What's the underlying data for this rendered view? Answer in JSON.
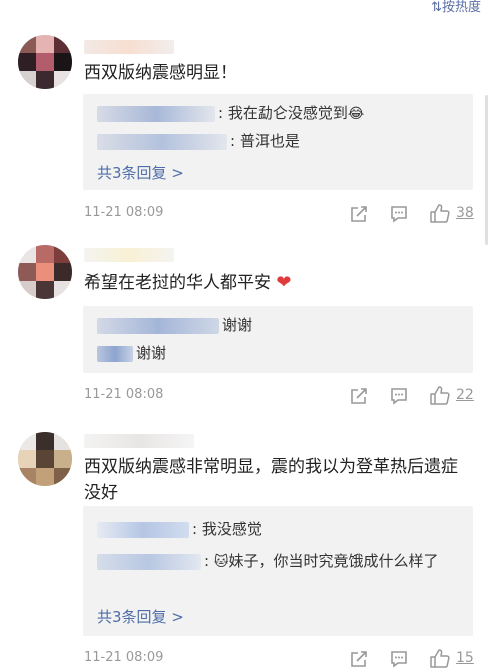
{
  "topbar": {
    "sort_label": "按热度"
  },
  "comments": [
    {
      "text": "西双版纳震感明显！",
      "replies": [
        {
          "text": ": 我在勐仑没感觉到",
          "emoji": "😂"
        },
        {
          "text": ": 普洱也是"
        }
      ],
      "more_label": "共3条回复 >",
      "time": "11-21 08:09",
      "likes": "38"
    },
    {
      "text": "希望在老挝的华人都平安",
      "emoji": "❤",
      "replies": [
        {
          "text": "谢谢"
        },
        {
          "text": "谢谢"
        }
      ],
      "time": "11-21 08:08",
      "likes": "22"
    },
    {
      "text": "西双版纳震感非常明显，震的我以为登革热后遗症没好",
      "replies": [
        {
          "text": ": 我没感觉"
        },
        {
          "text": "妹子，你当时究竟饿成什么样了",
          "emoji": "🐱"
        }
      ],
      "more_label": "共3条回复 >",
      "time": "11-21 08:09",
      "likes": "15"
    }
  ],
  "colors": {
    "link": "#4f6ea8",
    "meta": "#999999",
    "reply_bg": "#f2f2f2",
    "heart": "#e03b3b"
  },
  "icons": [
    "share-icon",
    "comment-icon",
    "like-icon"
  ]
}
